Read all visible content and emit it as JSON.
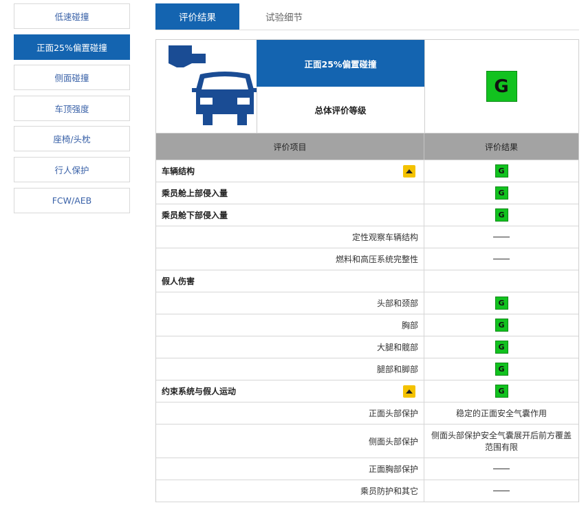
{
  "sidebar": {
    "items": [
      {
        "label": "低速碰撞",
        "active": false
      },
      {
        "label": "正面25%偏置碰撞",
        "active": true
      },
      {
        "label": "侧面碰撞",
        "active": false
      },
      {
        "label": "车顶强度",
        "active": false
      },
      {
        "label": "座椅/头枕",
        "active": false
      },
      {
        "label": "行人保护",
        "active": false
      },
      {
        "label": "FCW/AEB",
        "active": false
      }
    ]
  },
  "tabs": [
    {
      "label": "评价结果",
      "active": true
    },
    {
      "label": "试验细节",
      "active": false
    }
  ],
  "summary": {
    "test_name": "正面25%偏置碰撞",
    "overall_label": "总体评价等级",
    "overall_rating": "G"
  },
  "table": {
    "headers": [
      "评价项目",
      "评价结果"
    ],
    "rows": [
      {
        "item": "车辆结构",
        "level": "main",
        "result": "G",
        "result_type": "badge",
        "warning": true
      },
      {
        "item": "乘员舱上部侵入量",
        "level": "main",
        "result": "G",
        "result_type": "badge",
        "warning": false
      },
      {
        "item": "乘员舱下部侵入量",
        "level": "main",
        "result": "G",
        "result_type": "badge",
        "warning": false
      },
      {
        "item": "定性观察车辆结构",
        "level": "sub",
        "result": "",
        "result_type": "dash",
        "warning": false
      },
      {
        "item": "燃料和高压系统完整性",
        "level": "sub",
        "result": "",
        "result_type": "dash",
        "warning": false
      },
      {
        "item": "假人伤害",
        "level": "main",
        "result": "",
        "result_type": "none",
        "warning": false
      },
      {
        "item": "头部和颈部",
        "level": "sub",
        "result": "G",
        "result_type": "badge",
        "warning": false
      },
      {
        "item": "胸部",
        "level": "sub",
        "result": "G",
        "result_type": "badge",
        "warning": false
      },
      {
        "item": "大腿和髋部",
        "level": "sub",
        "result": "G",
        "result_type": "badge",
        "warning": false
      },
      {
        "item": "腿部和脚部",
        "level": "sub",
        "result": "G",
        "result_type": "badge",
        "warning": false
      },
      {
        "item": "约束系统与假人运动",
        "level": "main",
        "result": "G",
        "result_type": "badge",
        "warning": true
      },
      {
        "item": "正面头部保护",
        "level": "sub",
        "result": "稳定的正面安全气囊作用",
        "result_type": "text",
        "warning": false
      },
      {
        "item": "侧面头部保护",
        "level": "sub",
        "result": "侧面头部保护安全气囊展开后前方覆盖范围有限",
        "result_type": "text",
        "warning": false,
        "tall": true
      },
      {
        "item": "正面胸部保护",
        "level": "sub",
        "result": "",
        "result_type": "dash",
        "warning": false
      },
      {
        "item": "乘员防护和其它",
        "level": "sub",
        "result": "",
        "result_type": "dash",
        "warning": false
      }
    ]
  },
  "colors": {
    "primary": "#1464b0",
    "rating_good": "#12c21f",
    "warning": "#f4c200",
    "header_gray": "#a3a3a3"
  },
  "icons": {
    "car": "car-front-icon",
    "barrier": "barrier-icon",
    "warning": "warning-triangle-icon"
  }
}
